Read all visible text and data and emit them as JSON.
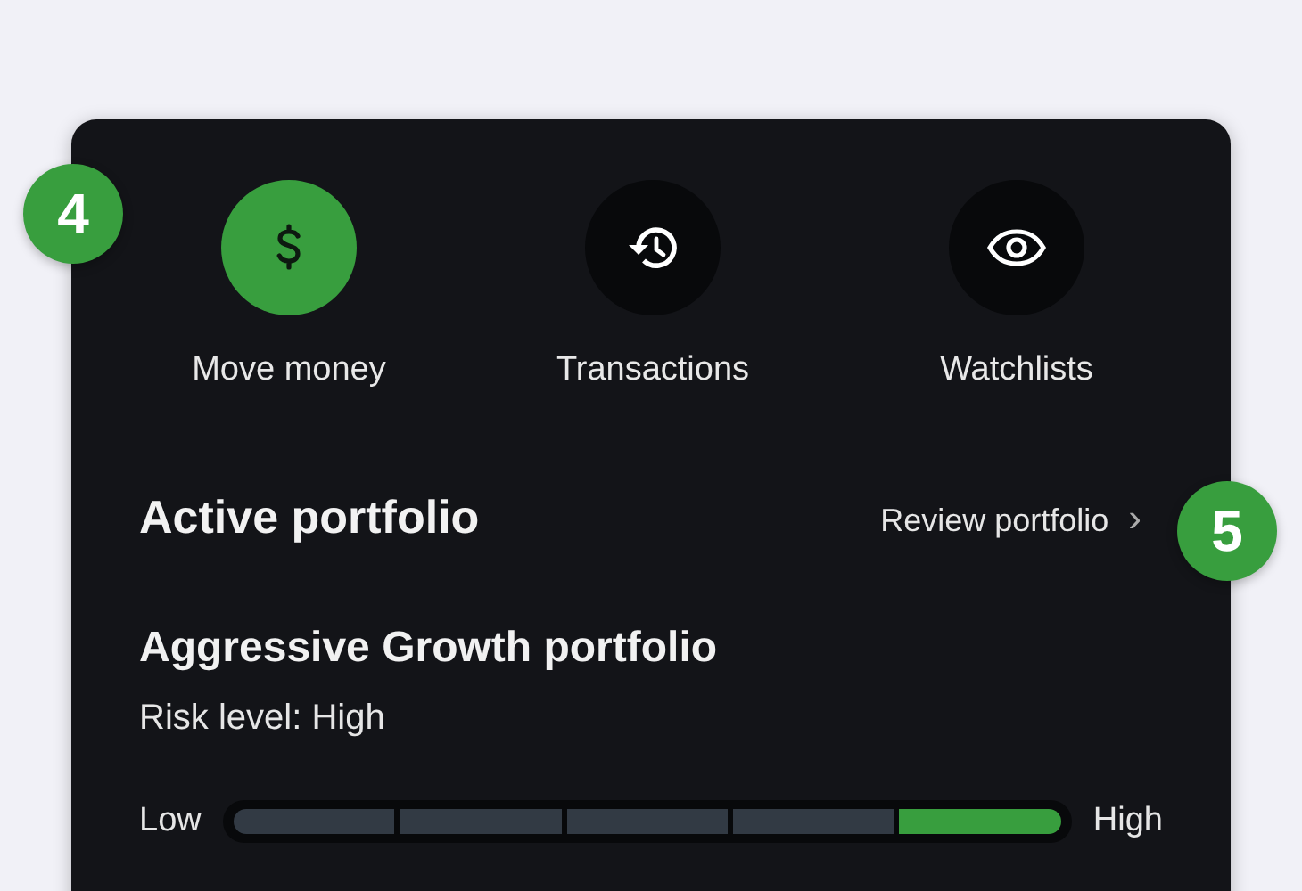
{
  "step_badges": [
    {
      "label": "4"
    },
    {
      "label": "5"
    }
  ],
  "actions": [
    {
      "label": "Move money",
      "kind": "dollar",
      "selected": true
    },
    {
      "label": "Transactions",
      "kind": "history",
      "selected": false
    },
    {
      "label": "Watchlists",
      "kind": "eye",
      "selected": false
    }
  ],
  "active_portfolio": {
    "title": "Active portfolio",
    "link": "Review portfolio",
    "chevron": "›",
    "name": "Aggressive Growth portfolio",
    "risk_level": "Risk level: High",
    "risk_scale": {
      "low_label": "Low",
      "high_label": "High",
      "segments": [
        {
          "selected": false
        },
        {
          "selected": false
        },
        {
          "selected": false
        },
        {
          "selected": false
        },
        {
          "selected": true
        }
      ]
    }
  }
}
